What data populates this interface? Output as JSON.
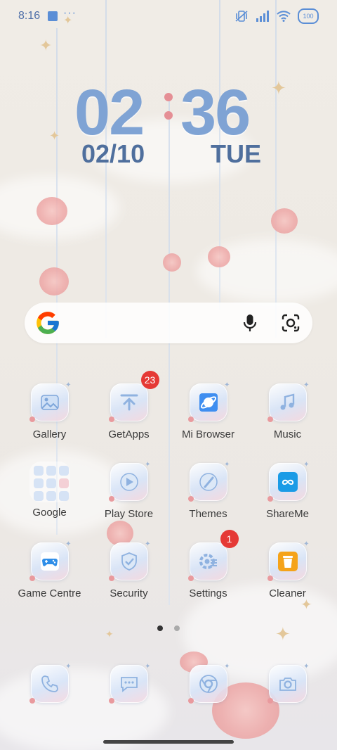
{
  "status_bar": {
    "time": "8:16",
    "more": "···",
    "battery": "100"
  },
  "clock": {
    "hours": "02",
    "minutes": "36",
    "date": "02/10",
    "weekday": "TUE"
  },
  "search_widget": {
    "logo_icon": "google-g-icon",
    "mic_icon": "microphone-icon",
    "lens_icon": "google-lens-icon"
  },
  "apps": [
    {
      "label": "Gallery",
      "icon": "gallery-icon"
    },
    {
      "label": "GetApps",
      "icon": "getapps-icon",
      "badge": "23"
    },
    {
      "label": "Mi Browser",
      "icon": "browser-icon"
    },
    {
      "label": "Music",
      "icon": "music-icon"
    },
    {
      "label": "Google",
      "icon": "folder-icon"
    },
    {
      "label": "Play Store",
      "icon": "play-store-icon"
    },
    {
      "label": "Themes",
      "icon": "themes-icon"
    },
    {
      "label": "ShareMe",
      "icon": "shareme-icon"
    },
    {
      "label": "Game Centre",
      "icon": "gamepad-icon"
    },
    {
      "label": "Security",
      "icon": "shield-icon"
    },
    {
      "label": "Settings",
      "icon": "gear-icon",
      "badge": "1"
    },
    {
      "label": "Cleaner",
      "icon": "trash-icon"
    }
  ],
  "dock": [
    {
      "icon": "phone-icon"
    },
    {
      "icon": "messages-icon"
    },
    {
      "icon": "chrome-icon"
    },
    {
      "icon": "camera-icon"
    }
  ],
  "pager": {
    "pages": 2,
    "active": 1
  },
  "colors": {
    "accent_blue": "#5b8ed6",
    "clock_blue": "#7fa3d4",
    "date_blue": "#4f6f9d",
    "badge_red": "#e53935"
  }
}
